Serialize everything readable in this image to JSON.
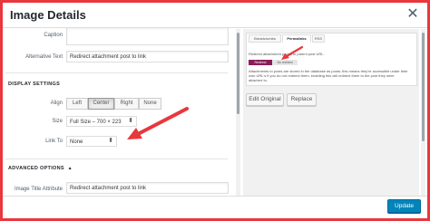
{
  "dialog": {
    "title": "Image Details",
    "close_icon": "close-icon"
  },
  "left": {
    "caption": {
      "label": "Caption",
      "value": ""
    },
    "alt_text": {
      "label": "Alternative Text",
      "value": "Redirect attachment post to link"
    },
    "display_settings": {
      "heading": "DISPLAY SETTINGS",
      "align": {
        "label": "Align",
        "options": [
          "Left",
          "Center",
          "Right",
          "None"
        ],
        "selected": "Center"
      },
      "size": {
        "label": "Size",
        "value": "Full Size – 700 × 223"
      },
      "link_to": {
        "label": "Link To",
        "value": "None"
      }
    },
    "advanced": {
      "heading": "ADVANCED OPTIONS",
      "toggle_icon": "triangle-up-icon",
      "image_title": {
        "label": "Image Title Attribute",
        "value": "Redirect attachment post to link"
      }
    }
  },
  "right": {
    "tabs": [
      "Breadcrumbs",
      "Permalinks",
      "RSS"
    ],
    "active_tab": "Permalinks",
    "redirect_text": "Redirect attachment pages to parent post URL.",
    "toggle": {
      "on": "Redirect",
      "off": "No redirect"
    },
    "note_lines": [
      "Attachments to posts are stored in the database as posts; this means they're accessible under their",
      "own URL's if you do not redirect them, enabling this will redirect them to the post they were",
      "attached to."
    ],
    "edit_original": "Edit Original",
    "replace": "Replace"
  },
  "footer": {
    "update": "Update"
  },
  "colors": {
    "annotation_arrow": "#e8373d",
    "primary_button": "#0085ba",
    "toggle_on": "#8a1c58"
  }
}
